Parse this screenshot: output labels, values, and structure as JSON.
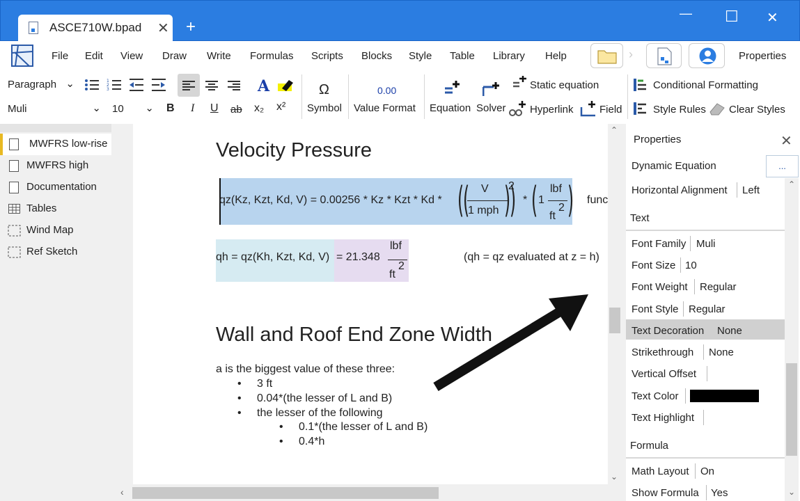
{
  "window": {
    "tab_title": "ASCE710W.bpad",
    "new_tab": "+",
    "minimize": "—",
    "maximize": "☐",
    "close": "✕"
  },
  "menu": [
    "File",
    "Edit",
    "View",
    "Draw",
    "Write",
    "Formulas",
    "Scripts",
    "Blocks",
    "Style",
    "Table",
    "Library",
    "Help"
  ],
  "properties_button": "Properties",
  "toolbar": {
    "paragraph_style": "Paragraph",
    "font_family": "Muli",
    "font_size": "10",
    "bold": "B",
    "italic": "I",
    "underline": "U",
    "strike": "ab",
    "subscript": "x₂",
    "superscript": "x²",
    "symbol_glyph": "Ω",
    "symbol": "Symbol",
    "value_format_glyph": "0.00",
    "value_format": "Value Format",
    "equation": "Equation",
    "solver": "Solver",
    "static_equation": "Static equation",
    "hyperlink": "Hyperlink",
    "field": "Field",
    "conditional_formatting": "Conditional Formatting",
    "style_rules": "Style Rules",
    "clear_styles": "Clear Styles",
    "text_color_glyph": "A"
  },
  "sidebar": {
    "items": [
      {
        "label": "MWFRS low-rise",
        "icon": "document-icon"
      },
      {
        "label": "MWFRS high",
        "icon": "document-icon"
      },
      {
        "label": "Documentation",
        "icon": "document-icon"
      },
      {
        "label": "Tables",
        "icon": "table-icon"
      },
      {
        "label": "Wind Map",
        "icon": "frame-icon"
      },
      {
        "label": "Ref Sketch",
        "icon": "frame-icon"
      }
    ]
  },
  "document": {
    "heading1": "Velocity Pressure",
    "eq1": {
      "lhs": "qz(Kz, Kzt, Kd, V) = 0.00256 * Kz * Kzt * Kd *",
      "frac_num": "V",
      "frac_den": "1 mph",
      "exp": "2",
      "times": "*",
      "one": "1",
      "unit_num": "lbf",
      "unit_den": "ft",
      "unit_exp": "2",
      "trailing": "func"
    },
    "eq2": {
      "lhs": "qh = qz(Kh, Kzt, Kd, V)",
      "result": "= 21.348",
      "unit_num": "lbf",
      "unit_den": "ft",
      "unit_exp": "2",
      "note": "(qh = qz evaluated at z = h)"
    },
    "heading2": "Wall and Roof End Zone Width",
    "intro": "a is the biggest value of these three:",
    "bullets": [
      "3 ft",
      "0.04*(the lesser of L and B)",
      "the lesser of the following"
    ],
    "sub_bullets": [
      "0.1*(the lesser of L and B)",
      "0.4*h"
    ]
  },
  "properties": {
    "title": "Properties",
    "type": "Dynamic Equation",
    "more_button": "...",
    "horizontal_alignment": {
      "label": "Horizontal Alignment",
      "value": "Left"
    },
    "section_text": "Text",
    "font_family": {
      "label": "Font Family",
      "value": "Muli"
    },
    "font_size": {
      "label": "Font Size",
      "value": "10"
    },
    "font_weight": {
      "label": "Font Weight",
      "value": "Regular"
    },
    "font_style": {
      "label": "Font Style",
      "value": "Regular"
    },
    "text_decoration": {
      "label": "Text Decoration",
      "value": "None"
    },
    "strikethrough": {
      "label": "Strikethrough",
      "value": "None"
    },
    "vertical_offset": {
      "label": "Vertical Offset",
      "value": ""
    },
    "text_color": {
      "label": "Text Color",
      "value": "#000000"
    },
    "text_highlight": {
      "label": "Text Highlight",
      "value": ""
    },
    "section_formula": "Formula",
    "math_layout": {
      "label": "Math Layout",
      "value": "On"
    },
    "show_formula": {
      "label": "Show Formula",
      "value": "Yes"
    }
  },
  "colors": {
    "titlebar": "#2b7de1",
    "eq1_highlight": "#b8d4ee",
    "eq2_highlight": "#d6ebf2",
    "eq2_result_highlight": "#e6dcf0",
    "selected_row": "#d0d0d0",
    "sidebar_accent": "#e8b923"
  }
}
